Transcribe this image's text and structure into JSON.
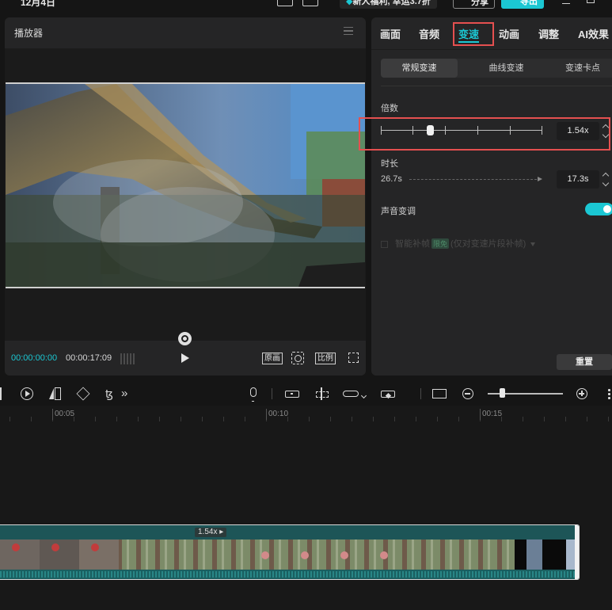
{
  "titlebar": {
    "date": "12月4日",
    "promo": "新人福利, 幸运3.7折",
    "share_label": "分享",
    "export_label": "导出"
  },
  "player": {
    "title": "播放器",
    "current_time": "00:00:00:00",
    "total_time": "00:00:17:09",
    "original_label": "原画",
    "ratio_label": "比例"
  },
  "props": {
    "tabs": [
      {
        "label": "画面"
      },
      {
        "label": "音频"
      },
      {
        "label": "变速"
      },
      {
        "label": "动画"
      },
      {
        "label": "调整"
      },
      {
        "label": "AI效果"
      }
    ],
    "active_tab": "变速",
    "subtabs": [
      {
        "label": "常规变速"
      },
      {
        "label": "曲线变速"
      },
      {
        "label": "变速卡点"
      }
    ],
    "speed": {
      "label": "倍数",
      "value": "1.54x"
    },
    "duration": {
      "label": "时长",
      "from": "26.7s",
      "to": "17.3s"
    },
    "pitch": {
      "label": "声音变调",
      "enabled": true
    },
    "smart_fill": {
      "label": "智能补帧",
      "badge": "限免",
      "note": "(仅对变速片段补帧)"
    },
    "reset_label": "重置"
  },
  "timeline": {
    "ruler": [
      "00:05",
      "00:10",
      "00:15"
    ],
    "clip_speed": "1.54x"
  },
  "colors": {
    "accent": "#1bc7d3",
    "highlight": "#e55050",
    "panel": "#252526"
  }
}
